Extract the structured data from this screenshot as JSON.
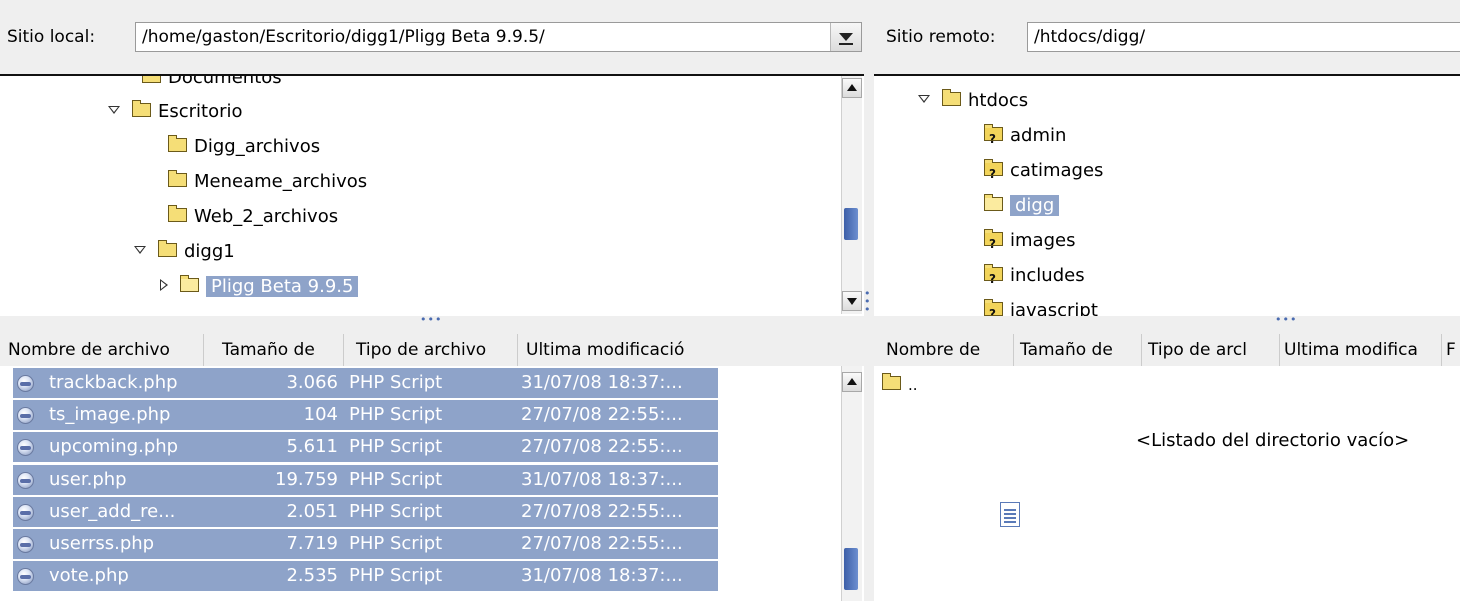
{
  "local": {
    "label": "Sitio local:",
    "path": "/home/gaston/Escritorio/digg1/Pligg Beta 9.9.5/",
    "tree": [
      {
        "label": "Documentos",
        "expander": "none",
        "icon": "folder-icon",
        "selected": false
      },
      {
        "label": "Escritorio",
        "expander": "open",
        "icon": "folder-icon",
        "selected": false
      },
      {
        "label": "Digg_archivos",
        "expander": "none",
        "icon": "folder-icon",
        "selected": false
      },
      {
        "label": "Meneame_archivos",
        "expander": "none",
        "icon": "folder-icon",
        "selected": false
      },
      {
        "label": "Web_2_archivos",
        "expander": "none",
        "icon": "folder-icon",
        "selected": false
      },
      {
        "label": "digg1",
        "expander": "open",
        "icon": "folder-icon",
        "selected": false
      },
      {
        "label": "Pligg Beta 9.9.5",
        "expander": "closed",
        "icon": "open-folder-icon",
        "selected": true
      }
    ],
    "columns": [
      "Nombre de archivo",
      "Tamaño de",
      "Tipo de archivo",
      "Ultima modificació"
    ],
    "files": [
      {
        "name": "trackback.php",
        "size": "3.066",
        "type": "PHP Script",
        "modified": "31/07/08 18:37:..."
      },
      {
        "name": "ts_image.php",
        "size": "104",
        "type": "PHP Script",
        "modified": "27/07/08 22:55:..."
      },
      {
        "name": "upcoming.php",
        "size": "5.611",
        "type": "PHP Script",
        "modified": "27/07/08 22:55:..."
      },
      {
        "name": "user.php",
        "size": "19.759",
        "type": "PHP Script",
        "modified": "31/07/08 18:37:..."
      },
      {
        "name": "user_add_re...",
        "size": "2.051",
        "type": "PHP Script",
        "modified": "27/07/08 22:55:..."
      },
      {
        "name": "userrss.php",
        "size": "7.719",
        "type": "PHP Script",
        "modified": "27/07/08 22:55:..."
      },
      {
        "name": "vote.php",
        "size": "2.535",
        "type": "PHP Script",
        "modified": "31/07/08 18:37:..."
      }
    ]
  },
  "remote": {
    "label": "Sitio remoto:",
    "path": "/htdocs/digg/",
    "tree": [
      {
        "label": "htdocs",
        "expander": "open",
        "icon": "folder-icon",
        "selected": false
      },
      {
        "label": "admin",
        "expander": "none",
        "icon": "unknown-folder-icon",
        "selected": false
      },
      {
        "label": "catimages",
        "expander": "none",
        "icon": "unknown-folder-icon",
        "selected": false
      },
      {
        "label": "digg",
        "expander": "none",
        "icon": "open-folder-icon",
        "selected": true
      },
      {
        "label": "images",
        "expander": "none",
        "icon": "unknown-folder-icon",
        "selected": false
      },
      {
        "label": "includes",
        "expander": "none",
        "icon": "unknown-folder-icon",
        "selected": false
      },
      {
        "label": "javascript",
        "expander": "none",
        "icon": "unknown-folder-icon",
        "selected": false
      }
    ],
    "columns": [
      "Nombre de",
      "Tamaño de",
      "Tipo de arcl",
      "Ultima modifica",
      "F"
    ],
    "parent_entry": "..",
    "empty_message": "<Listado del directorio vacío>"
  },
  "colors": {
    "selection": "#8ea3c9",
    "scroll_thumb": "#4a6bb0",
    "folder": "#f5de77"
  }
}
